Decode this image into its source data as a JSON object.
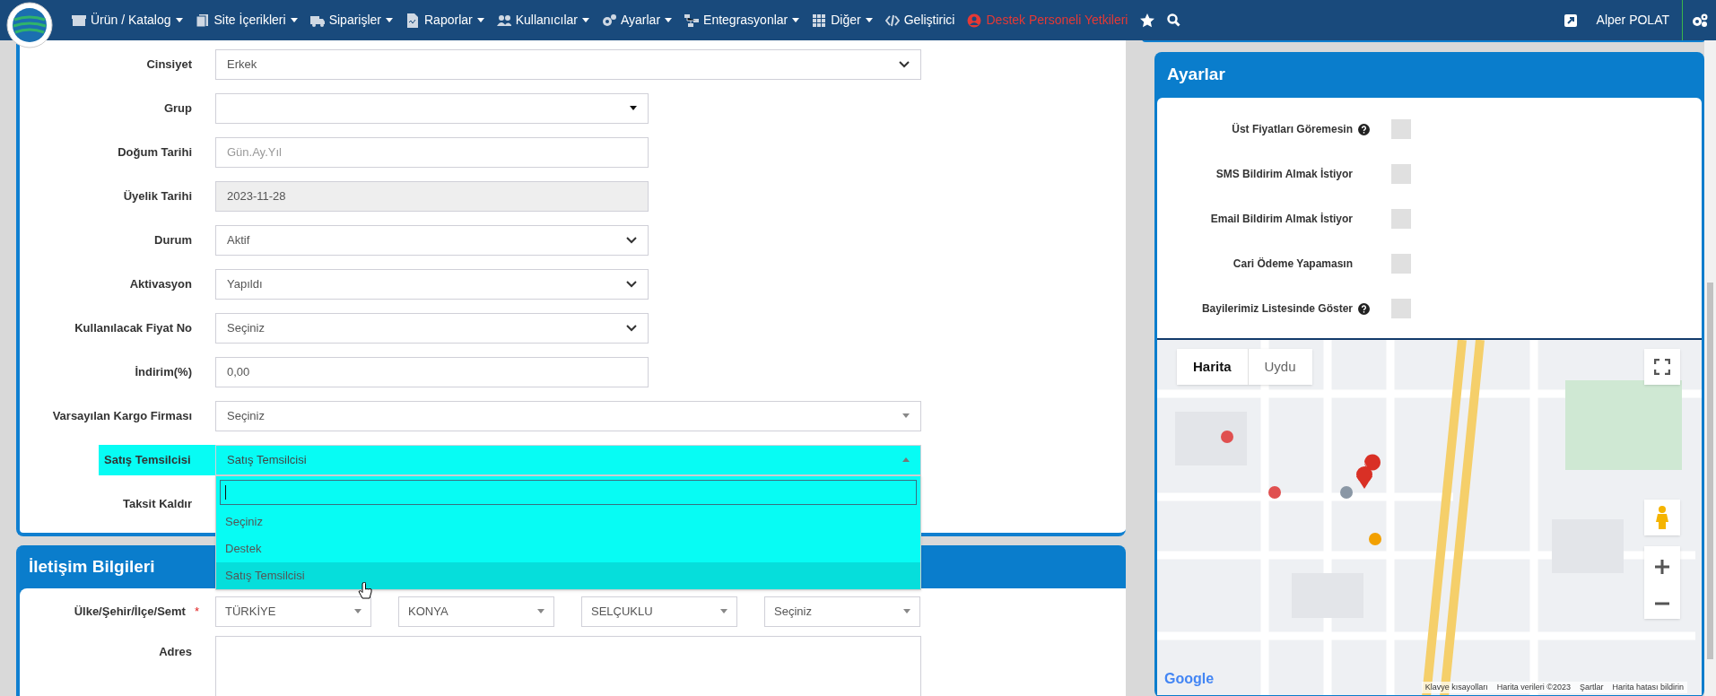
{
  "nav": {
    "items": [
      {
        "label": "Ürün / Katalog",
        "caret": true,
        "kind": "menu"
      },
      {
        "label": "Site İçerikleri",
        "caret": true,
        "kind": "menu"
      },
      {
        "label": "Siparişler",
        "caret": true,
        "kind": "menu"
      },
      {
        "label": "Raporlar",
        "caret": true,
        "kind": "menu"
      },
      {
        "label": "Kullanıcılar",
        "caret": true,
        "kind": "menu"
      },
      {
        "label": "Ayarlar",
        "caret": true,
        "kind": "menu"
      },
      {
        "label": "Entegrasyonlar",
        "caret": true,
        "kind": "menu"
      },
      {
        "label": "Diğer",
        "caret": true,
        "kind": "menu"
      },
      {
        "label": "Geliştirici",
        "caret": false,
        "kind": "menu"
      },
      {
        "label": "Destek Personeli Yetkileri",
        "caret": false,
        "kind": "alert"
      }
    ],
    "user": "Alper POLAT"
  },
  "form": {
    "rows": [
      {
        "label": "Cinsiyet",
        "kind": "select",
        "value": "Erkek"
      },
      {
        "label": "Grup",
        "kind": "combo",
        "value": ""
      },
      {
        "label": "Doğum Tarihi",
        "kind": "input",
        "placeholder": "Gün.Ay.Yıl"
      },
      {
        "label": "Üyelik Tarihi",
        "kind": "input",
        "value": "2023-11-28",
        "disabled": true
      },
      {
        "label": "Durum",
        "kind": "select",
        "value": "Aktif"
      },
      {
        "label": "Aktivasyon",
        "kind": "select",
        "value": "Yapıldı"
      },
      {
        "label": "Kullanılacak Fiyat No",
        "kind": "select",
        "value": "Seçiniz"
      },
      {
        "label": "İndirim(%)",
        "kind": "input",
        "value": "0,00"
      },
      {
        "label": "Varsayılan Kargo Firması",
        "kind": "combo",
        "value": "Seçiniz"
      },
      {
        "label": "Satış Temsilcisi",
        "kind": "combo",
        "value": "Satış Temsilcisi",
        "highlighted": true,
        "expanded": true,
        "options": [
          {
            "label": "Seçiniz",
            "selected": false
          },
          {
            "label": "Destek",
            "selected": false
          },
          {
            "label": "Satış Temsilcisi",
            "selected": true
          }
        ]
      },
      {
        "label": "Taksit Kaldır",
        "kind": "label"
      }
    ]
  },
  "contact": {
    "title": "İletişim Bilgileri",
    "location": {
      "label": "Ülke/Şehir/İlçe/Semt",
      "required": "*",
      "values": [
        "TÜRKİYE",
        "KONYA",
        "SELÇUKLU",
        "Seçiniz"
      ]
    },
    "address": {
      "label": "Adres"
    }
  },
  "settings": {
    "title": "Ayarlar",
    "items": [
      {
        "label": "Üst Fiyatları Göremesin",
        "help": true,
        "checked": false
      },
      {
        "label": "SMS Bildirim Almak İstiyor",
        "help": false,
        "checked": false
      },
      {
        "label": "Email Bildirim Almak İstiyor",
        "help": false,
        "checked": false
      },
      {
        "label": "Cari Ödeme Yapamasın",
        "help": false,
        "checked": false
      },
      {
        "label": "Bayilerimiz Listesinde Göster",
        "help": true,
        "checked": false
      }
    ]
  },
  "map": {
    "kind": "picture",
    "map_types": [
      {
        "label": "Harita",
        "selected": true
      },
      {
        "label": "Uydu",
        "selected": false
      }
    ],
    "logo": "Google",
    "footer": [
      "Klavye kısayolları",
      "Harita verileri ©2023",
      "Şartlar",
      "Harita hatası bildirin"
    ]
  }
}
